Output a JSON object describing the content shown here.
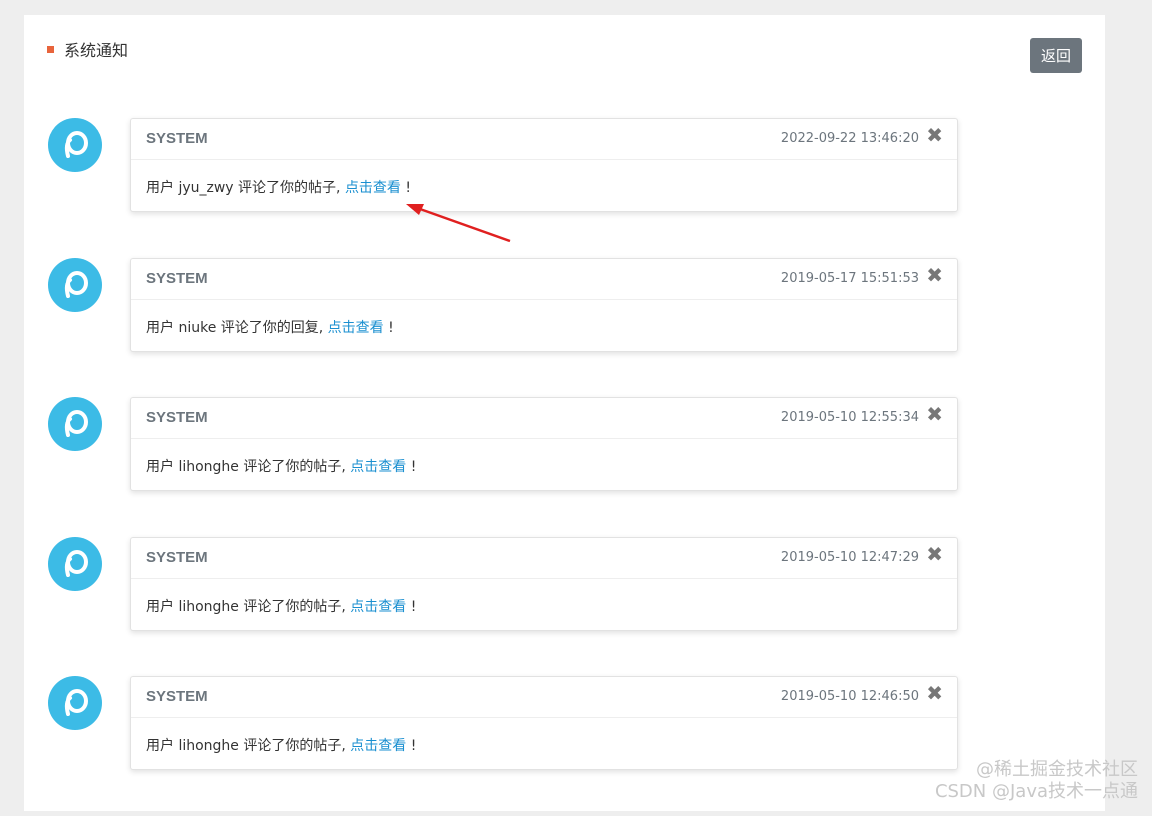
{
  "page": {
    "title": "系统通知",
    "back_label": "返回"
  },
  "messages": [
    {
      "sender": "SYSTEM",
      "time": "2022-09-22 13:46:20",
      "prefix": "用户 jyu_zwy 评论了你的帖子, ",
      "link": "点击查看",
      "suffix": " !"
    },
    {
      "sender": "SYSTEM",
      "time": "2019-05-17 15:51:53",
      "prefix": "用户 niuke 评论了你的回复, ",
      "link": "点击查看",
      "suffix": " !"
    },
    {
      "sender": "SYSTEM",
      "time": "2019-05-10 12:55:34",
      "prefix": "用户 lihonghe 评论了你的帖子, ",
      "link": "点击查看",
      "suffix": " !"
    },
    {
      "sender": "SYSTEM",
      "time": "2019-05-10 12:47:29",
      "prefix": "用户 lihonghe 评论了你的帖子, ",
      "link": "点击查看",
      "suffix": " !"
    },
    {
      "sender": "SYSTEM",
      "time": "2019-05-10 12:46:50",
      "prefix": "用户 lihonghe 评论了你的帖子, ",
      "link": "点击查看",
      "suffix": " !"
    }
  ],
  "icons": {
    "close": "close-icon",
    "avatar": "system-avatar-icon"
  },
  "colors": {
    "accent": "#e8643c",
    "avatar": "#3cbbe6",
    "link": "#1a8fd0",
    "arrow": "#e02020"
  },
  "watermark": {
    "line1": "@稀土掘金技术社区",
    "line2": "CSDN @Java技术一点通"
  }
}
